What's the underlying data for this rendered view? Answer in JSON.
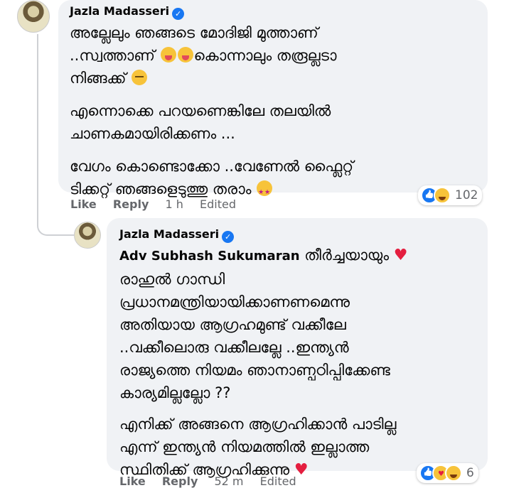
{
  "comment1": {
    "author": "Jazla Madasseri",
    "lines": [
      "അല്ലേലും ഞങ്ങടെ മോദിജി മുത്താണ്",
      "..സ്വത്താണ്",
      "കൊന്നാലും തരൂല്ലടാ",
      "നിങ്ങക്ക്"
    ],
    "para2": [
      "എന്നൊക്കെ പറയണെങ്കിലേ തലയിൽ",
      "ചാണകമായിരിക്കണം ..."
    ],
    "para3": [
      "വേഗം കൊണ്ടൊക്കോ ..വേണേൽ ഫ്ലൈറ്റ്",
      "ടിക്കറ്റ് ഞങ്ങളെടുത്തു തരാം"
    ],
    "emoji_names": [
      "squinting-tongue-emoji",
      "zany-tongue-emoji",
      "sleepy-emoji",
      "star-struck-emoji"
    ],
    "actions": {
      "like": "Like",
      "reply": "Reply",
      "time": "1 h",
      "edited": "Edited"
    },
    "reaction_count": "102",
    "reactions": [
      "like",
      "haha"
    ]
  },
  "comment2": {
    "author": "Jazla Madasseri",
    "mention": "Adv Subhash Sukumaran",
    "line1_rest": "തീർച്ചയായും",
    "lines": [
      "രാഹുൽ ഗാന്ധി",
      "പ്രധാനമന്ത്രിയായിക്കാണണമെന്നു",
      "അതിയായ ആഗ്രഹമുണ്ട് വക്കീലേ",
      "..വക്കീലൊരു വക്കീലല്ലേ ..ഇന്ത്യൻ",
      "രാജ്യത്തെ നിയമം ഞാനാണ്പഠിപ്പിക്കേണ്ട",
      "കാര്യമില്ലല്ലോ ??"
    ],
    "para2": [
      "എനിക്ക് അങ്ങനെ ആഗ്രഹിക്കാൻ പാടില്ല",
      "എന്ന് ഇന്ത്യൻ നിയമത്തിൽ ഇല്ലാത്ത",
      "സ്ഥിതിക്ക് ആഗ്രഹിക്കുന്നു"
    ],
    "actions": {
      "like": "Like",
      "reply": "Reply",
      "time": "52 m",
      "edited": "Edited"
    },
    "reaction_count": "6",
    "reactions": [
      "like",
      "care",
      "haha"
    ]
  },
  "colors": {
    "bubble": "#f0f2f5",
    "verified": "#1877f2",
    "meta": "#65676b",
    "heart": "#e41e3f"
  }
}
